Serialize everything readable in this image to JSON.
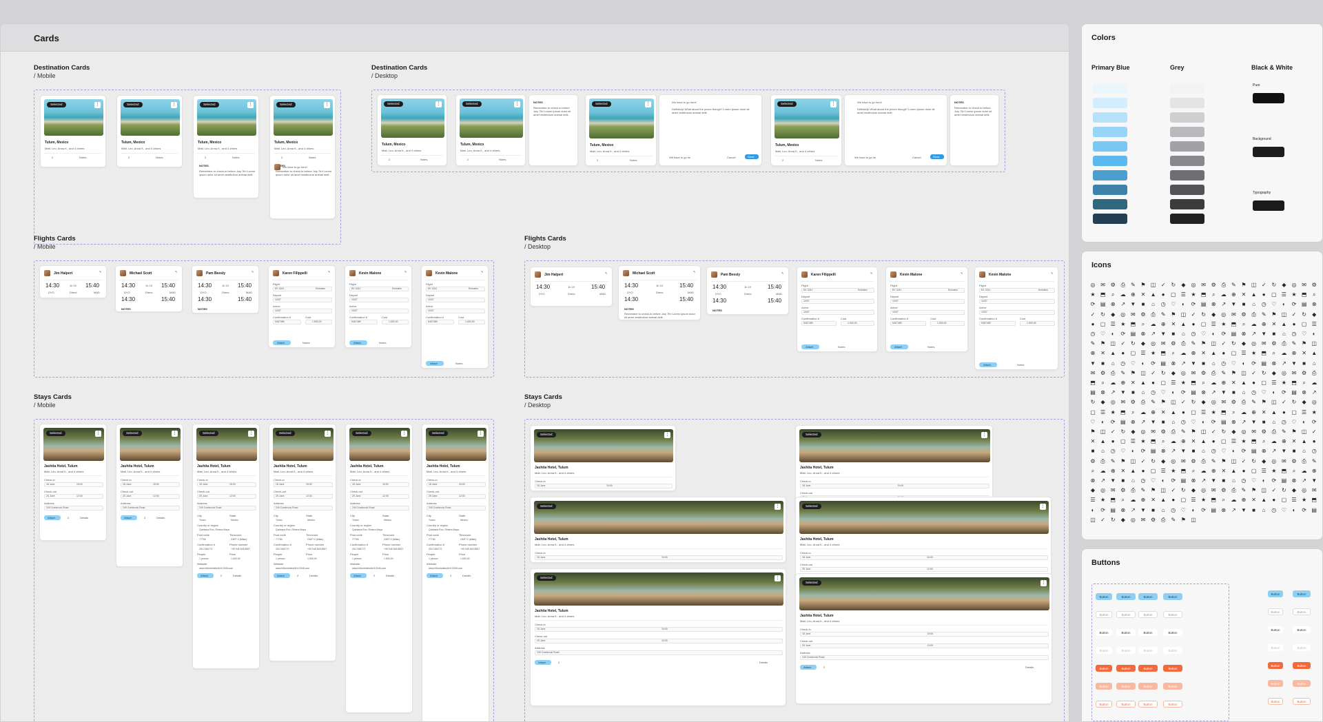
{
  "board": {
    "title": "Cards",
    "sections": {
      "dest_mobile": {
        "title": "Destination Cards",
        "sub": "/ Mobile"
      },
      "dest_desktop": {
        "title": "Destination Cards",
        "sub": "/ Desktop"
      },
      "flights_mobile": {
        "title": "Flights Cards",
        "sub": "/ Mobile"
      },
      "flights_desktop": {
        "title": "Flights Cards",
        "sub": "/ Desktop"
      },
      "stays_mobile": {
        "title": "Stays Cards",
        "sub": "/ Mobile"
      },
      "stays_desktop": {
        "title": "Stays Cards",
        "sub": "/ Desktop"
      }
    }
  },
  "dest": {
    "selected": "Selected",
    "place": "Tulum, Mexico",
    "people": "Matt, Leo, Anna K., and 4 others",
    "comments": "2",
    "notes_label": "Notes",
    "notes_heading": "NOTES",
    "notes_text": "Remember to check-in before July 7th! Lorem ipsum dolor sit amet vestibulum animal delit.",
    "msg1": "We have to go here!",
    "msg2": "Definitely! What about the prices though? Lorem ipsum dolor sit amet vestibulum animal delit.",
    "input_value": "We have to go he",
    "add_comment": "Add comment",
    "close": "Close",
    "cancel": "Cancel",
    "send": "Send"
  },
  "flights": {
    "names": [
      "Jim Halpert",
      "Michael Scott",
      "Pam Beesly",
      "Karen Filippelli",
      "Kevin Malone",
      "Kevin Malone"
    ],
    "dep_time": "14:30",
    "arr_time": "15:40",
    "duration": "1h 10",
    "from": "DYO",
    "to": "MAD",
    "stops": "Direct",
    "flight_label": "Flight",
    "flight_no": "EK 3241",
    "airline": "Emirates",
    "depart_label": "Depart",
    "arrive_label": "Arrive",
    "depart_date": "10/07",
    "arrive_date": "10/07",
    "confirmation_label": "Confirmation #",
    "confirmation": "5467489",
    "cost_label": "Cost",
    "cost": "1.500,00",
    "attach": "Attach",
    "notes": "Notes",
    "notes_heading": "NOTES",
    "notes_text": "Remember to check-in before July 7th! Lorem ipsum dolor sit amet vestibulum animal delit."
  },
  "stays": {
    "selected": "Selected",
    "hotel": "Jashita Hotel, Tulum",
    "people": "Matt, Leo, Anna K., and 4 others",
    "checkin_label": "Check-in",
    "checkin_date": "18 June",
    "checkin_time": "15:00",
    "checkout_label": "Check-out",
    "checkout_date": "25 June",
    "checkout_time": "12:00",
    "address_label": "Address",
    "address": "249 Cranbrook Road",
    "city_label": "City",
    "city": "Tulum",
    "state_label": "State",
    "state": "Mexico",
    "country_label": "Country or region",
    "country": "Quintana Roo, Riviera Maya",
    "postcode_label": "Post code",
    "postcode": "77760",
    "timezone_label": "Timezone",
    "timezone": "GMT+2 (Milan)",
    "confirmation_label": "Confirmation #",
    "confirmation": "2017454772",
    "phone_label": "Phone number",
    "phone": "+39 045 645 8837",
    "people_label": "People",
    "people_count": "1 person",
    "price_label": "Price",
    "price": "1.500,00",
    "website_label": "Website",
    "website": "www.hiltonhotels/AH12345.com",
    "attach": "Attach",
    "comments": "2",
    "details": "Details"
  },
  "colors_panel": {
    "title": "Colors",
    "groups": [
      "Primary Blue",
      "Grey",
      "Black & White"
    ],
    "bw_labels": [
      "Pure",
      "Background",
      "Typography"
    ],
    "blue": [
      "#eaf6fd",
      "#d3edfc",
      "#b5e1fa",
      "#97d4f7",
      "#79c7f4",
      "#5cb9ef",
      "#4a9fcf",
      "#3d83a9",
      "#30677f",
      "#253f52"
    ],
    "grey": [
      "#f3f3f4",
      "#e4e4e6",
      "#cfcfd2",
      "#b9b9bd",
      "#a1a1a6",
      "#88888d",
      "#6e6e73",
      "#545458",
      "#3b3b3e",
      "#222224"
    ]
  },
  "icons_panel": {
    "title": "Icons"
  },
  "buttons_panel": {
    "title": "Buttons",
    "label": "Button"
  }
}
